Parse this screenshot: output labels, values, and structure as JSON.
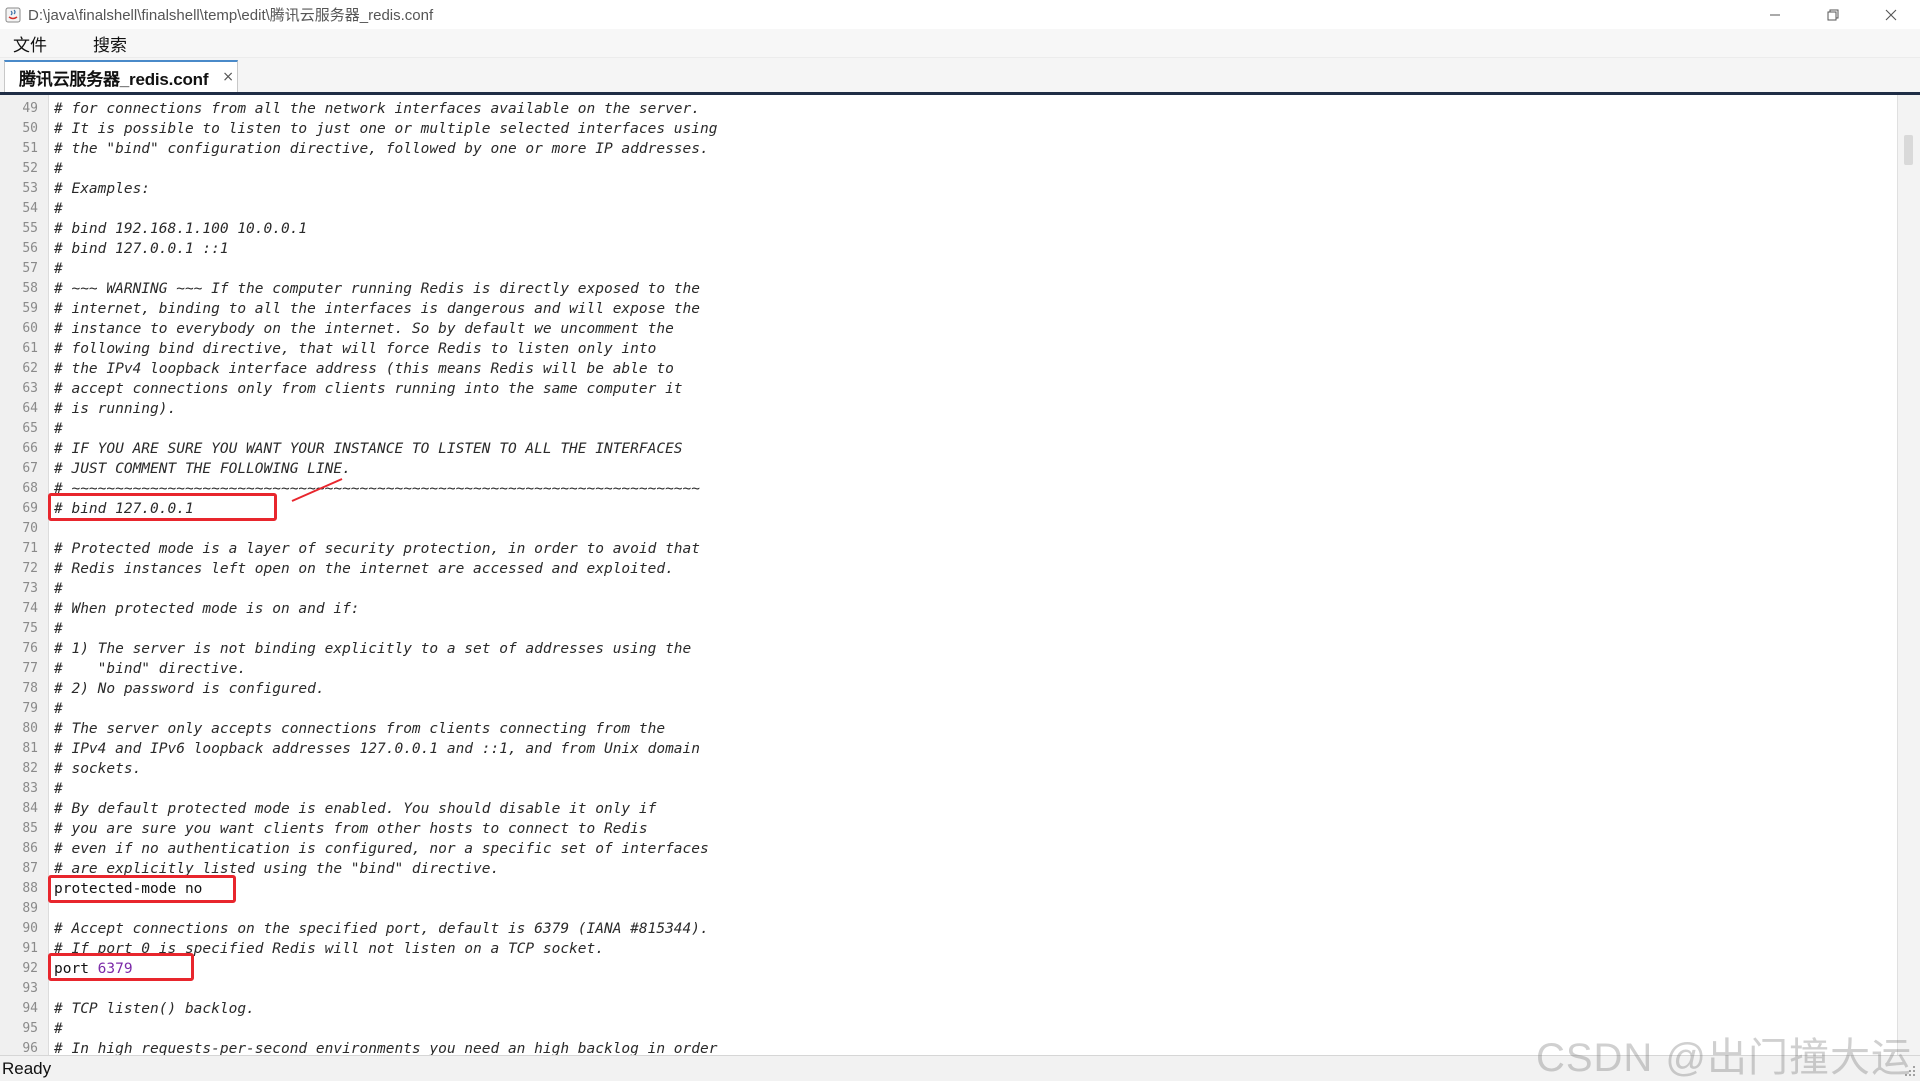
{
  "window": {
    "title": "D:\\java\\finalshell\\finalshell\\temp\\edit\\腾讯云服务器_redis.conf"
  },
  "menu": [
    "文件",
    "搜索"
  ],
  "tab": {
    "label": "腾讯云服务器_redis.conf",
    "close": "×"
  },
  "status": {
    "text": "Ready"
  },
  "watermark": "CSDN @出门撞大运",
  "editor": {
    "lines": [
      {
        "n": "49",
        "t": "# for connections from all the network interfaces available on the server.",
        "k": "comment"
      },
      {
        "n": "50",
        "t": "# It is possible to listen to just one or multiple selected interfaces using",
        "k": "comment"
      },
      {
        "n": "51",
        "t": "# the \"bind\" configuration directive, followed by one or more IP addresses.",
        "k": "comment"
      },
      {
        "n": "52",
        "t": "#",
        "k": "comment"
      },
      {
        "n": "53",
        "t": "# Examples:",
        "k": "comment"
      },
      {
        "n": "54",
        "t": "#",
        "k": "comment"
      },
      {
        "n": "55",
        "t": "# bind 192.168.1.100 10.0.0.1",
        "k": "comment"
      },
      {
        "n": "56",
        "t": "# bind 127.0.0.1 ::1",
        "k": "comment"
      },
      {
        "n": "57",
        "t": "#",
        "k": "comment"
      },
      {
        "n": "58",
        "t": "# ~~~ WARNING ~~~ If the computer running Redis is directly exposed to the",
        "k": "comment"
      },
      {
        "n": "59",
        "t": "# internet, binding to all the interfaces is dangerous and will expose the",
        "k": "comment"
      },
      {
        "n": "60",
        "t": "# instance to everybody on the internet. So by default we uncomment the",
        "k": "comment"
      },
      {
        "n": "61",
        "t": "# following bind directive, that will force Redis to listen only into",
        "k": "comment"
      },
      {
        "n": "62",
        "t": "# the IPv4 loopback interface address (this means Redis will be able to",
        "k": "comment"
      },
      {
        "n": "63",
        "t": "# accept connections only from clients running into the same computer it",
        "k": "comment"
      },
      {
        "n": "64",
        "t": "# is running).",
        "k": "comment"
      },
      {
        "n": "65",
        "t": "#",
        "k": "comment"
      },
      {
        "n": "66",
        "t": "# IF YOU ARE SURE YOU WANT YOUR INSTANCE TO LISTEN TO ALL THE INTERFACES",
        "k": "comment"
      },
      {
        "n": "67",
        "t": "# JUST COMMENT THE FOLLOWING LINE.",
        "k": "comment"
      },
      {
        "n": "68",
        "t": "# ~~~~~~~~~~~~~~~~~~~~~~~~~~~~~~~~~~~~~~~~~~~~~~~~~~~~~~~~~~~~~~~~~~~~~~~~",
        "k": "comment"
      },
      {
        "n": "69",
        "t": "# bind 127.0.0.1",
        "k": "comment"
      },
      {
        "n": "70",
        "t": "",
        "k": "comment"
      },
      {
        "n": "71",
        "t": "# Protected mode is a layer of security protection, in order to avoid that",
        "k": "comment"
      },
      {
        "n": "72",
        "t": "# Redis instances left open on the internet are accessed and exploited.",
        "k": "comment"
      },
      {
        "n": "73",
        "t": "#",
        "k": "comment"
      },
      {
        "n": "74",
        "t": "# When protected mode is on and if:",
        "k": "comment"
      },
      {
        "n": "75",
        "t": "#",
        "k": "comment"
      },
      {
        "n": "76",
        "t": "# 1) The server is not binding explicitly to a set of addresses using the",
        "k": "comment"
      },
      {
        "n": "77",
        "t": "#    \"bind\" directive.",
        "k": "comment"
      },
      {
        "n": "78",
        "t": "# 2) No password is configured.",
        "k": "comment"
      },
      {
        "n": "79",
        "t": "#",
        "k": "comment"
      },
      {
        "n": "80",
        "t": "# The server only accepts connections from clients connecting from the",
        "k": "comment"
      },
      {
        "n": "81",
        "t": "# IPv4 and IPv6 loopback addresses 127.0.0.1 and ::1, and from Unix domain",
        "k": "comment"
      },
      {
        "n": "82",
        "t": "# sockets.",
        "k": "comment"
      },
      {
        "n": "83",
        "t": "#",
        "k": "comment"
      },
      {
        "n": "84",
        "t": "# By default protected mode is enabled. You should disable it only if",
        "k": "comment"
      },
      {
        "n": "85",
        "t": "# you are sure you want clients from other hosts to connect to Redis",
        "k": "comment"
      },
      {
        "n": "86",
        "t": "# even if no authentication is configured, nor a specific set of interfaces",
        "k": "comment"
      },
      {
        "n": "87",
        "t": "# are explicitly listed using the \"bind\" directive.",
        "k": "comment"
      },
      {
        "n": "88",
        "t": "protected-mode no",
        "k": "plain"
      },
      {
        "n": "89",
        "t": "",
        "k": "plain"
      },
      {
        "n": "90",
        "t": "# Accept connections on the specified port, default is 6379 (IANA #815344).",
        "k": "comment"
      },
      {
        "n": "91",
        "t": "# If port 0 is specified Redis will not listen on a TCP socket.",
        "k": "comment"
      },
      {
        "n": "92",
        "t": "port ",
        "k": "port",
        "v": "6379"
      },
      {
        "n": "93",
        "t": "",
        "k": "plain"
      },
      {
        "n": "94",
        "t": "# TCP listen() backlog.",
        "k": "comment"
      },
      {
        "n": "95",
        "t": "#",
        "k": "comment"
      },
      {
        "n": "96",
        "t": "# In high requests-per-second environments you need an high backlog in order",
        "k": "comment"
      }
    ]
  },
  "colors": {
    "highlight": "#e8262d",
    "number": "#7b2aa8",
    "tab_accent": "#1f2d45"
  }
}
